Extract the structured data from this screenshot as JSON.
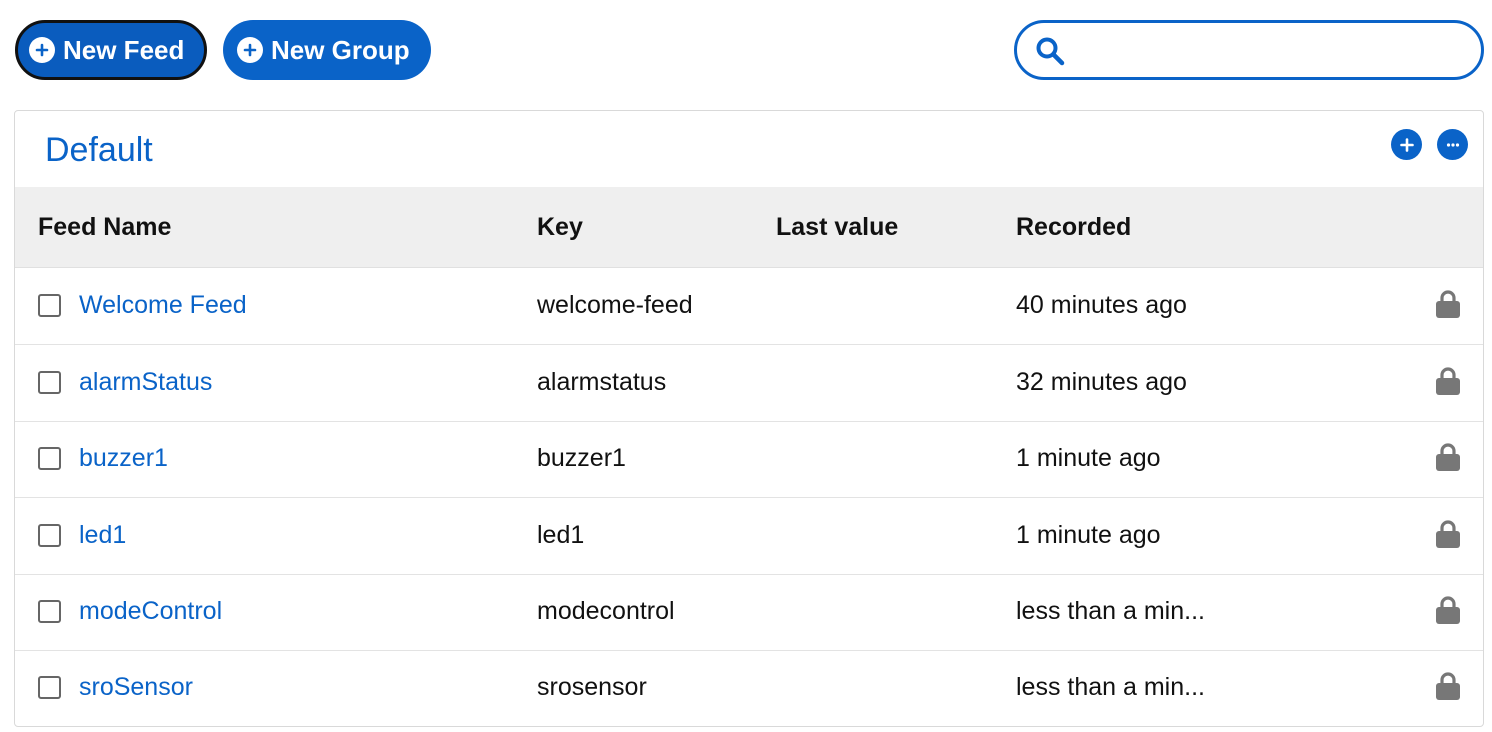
{
  "toolbar": {
    "new_feed_label": "New Feed",
    "new_group_label": "New Group",
    "search_value": "",
    "search_placeholder": ""
  },
  "group": {
    "title": "Default"
  },
  "table": {
    "columns": {
      "name": "Feed Name",
      "key": "Key",
      "last": "Last value",
      "recorded": "Recorded"
    },
    "rows": [
      {
        "name": "Welcome Feed",
        "key": "welcome-feed",
        "last": "",
        "recorded": "40 minutes ago",
        "locked": true
      },
      {
        "name": "alarmStatus",
        "key": "alarmstatus",
        "last": "",
        "recorded": "32 minutes ago",
        "locked": true
      },
      {
        "name": "buzzer1",
        "key": "buzzer1",
        "last": "",
        "recorded": "1 minute ago",
        "locked": true
      },
      {
        "name": "led1",
        "key": "led1",
        "last": "",
        "recorded": "1 minute ago",
        "locked": true
      },
      {
        "name": "modeControl",
        "key": "modecontrol",
        "last": "",
        "recorded": "less than a min...",
        "locked": true
      },
      {
        "name": "sroSensor",
        "key": "srosensor",
        "last": "",
        "recorded": "less than a min...",
        "locked": true
      }
    ]
  },
  "colors": {
    "accent": "#0a63c8",
    "header_bg": "#efefef",
    "lock": "#777777"
  },
  "icons": {
    "new_feed": "plus-circle-icon",
    "new_group": "plus-circle-icon",
    "search": "search-icon",
    "group_add": "plus-circle-icon",
    "group_more": "more-horizontal-icon",
    "row_lock": "lock-icon"
  }
}
